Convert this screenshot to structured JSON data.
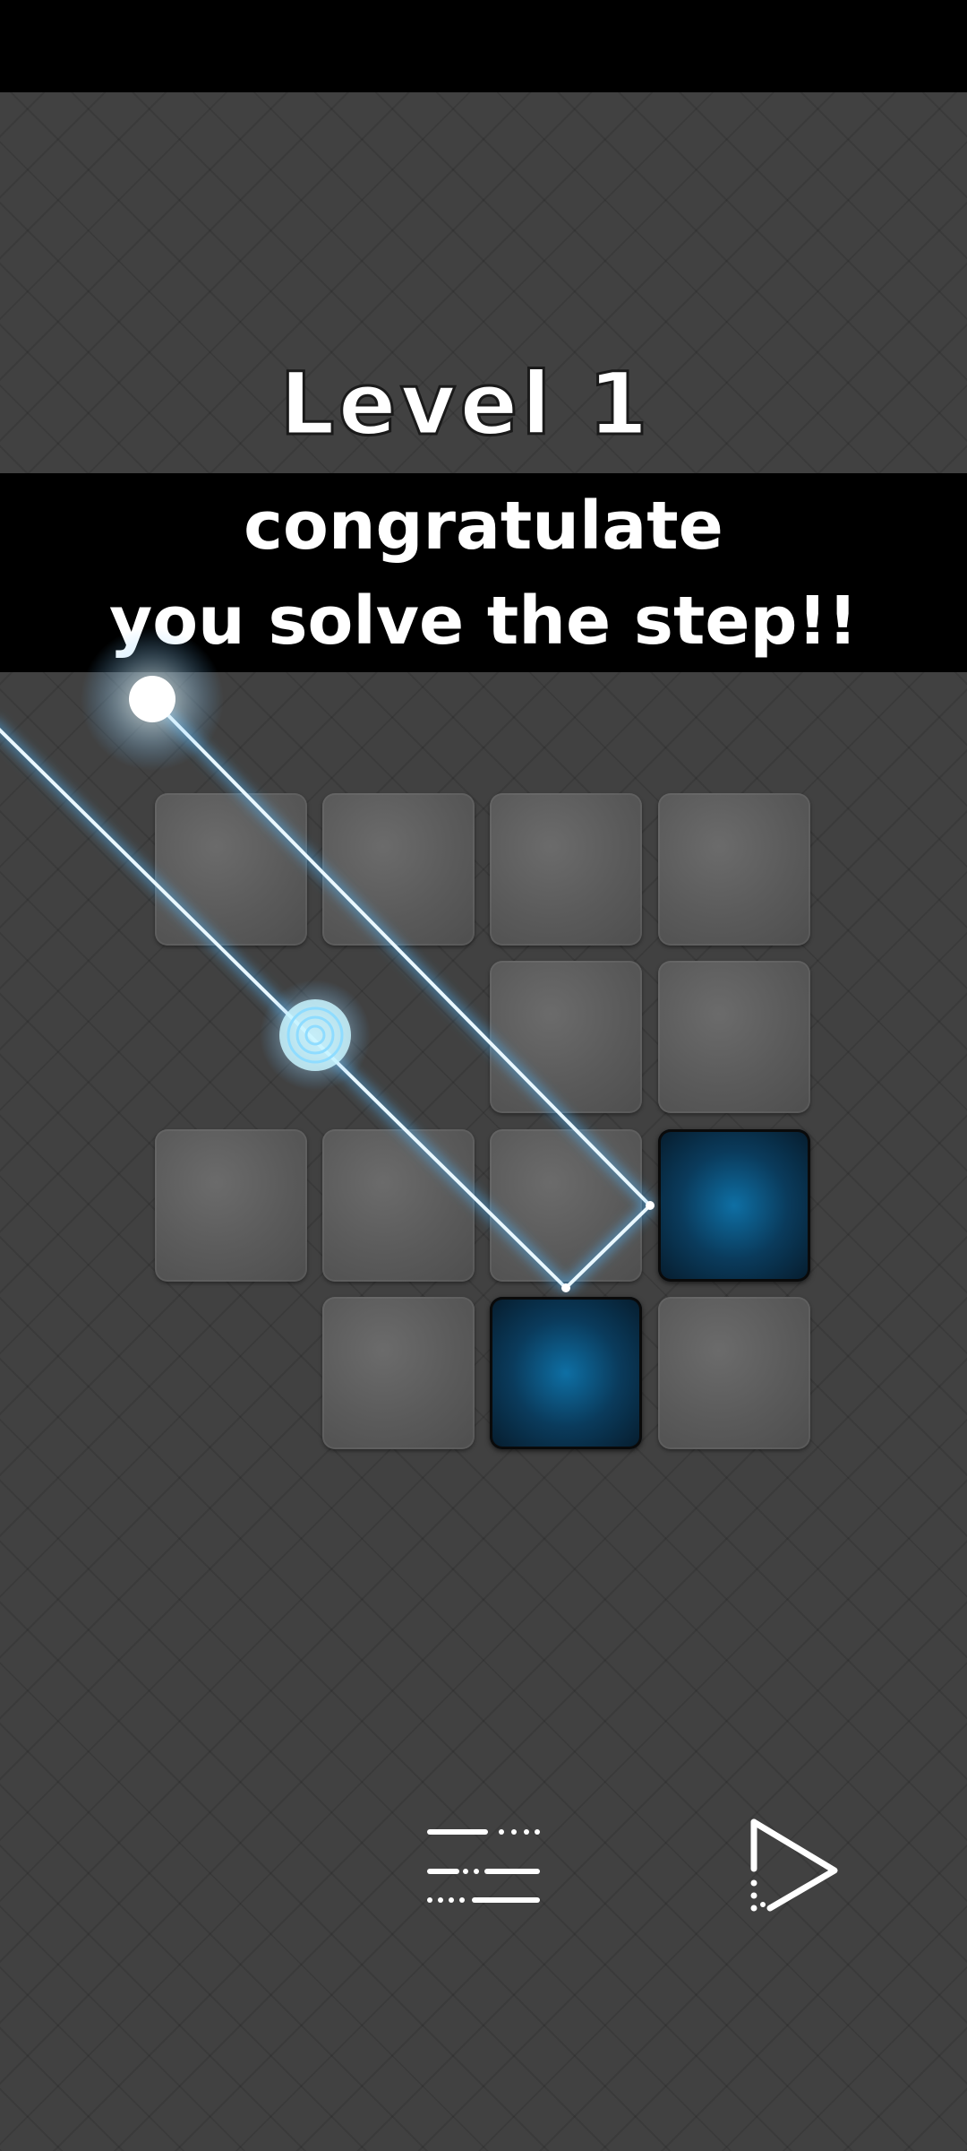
{
  "game": {
    "level_title": "Level 1",
    "banner": {
      "line1": "congratulate",
      "line2": "you solve the step!!"
    },
    "board": {
      "tiles": [
        {
          "row": 0,
          "col": 0,
          "state": "stone"
        },
        {
          "row": 0,
          "col": 1,
          "state": "stone"
        },
        {
          "row": 0,
          "col": 2,
          "state": "stone"
        },
        {
          "row": 0,
          "col": 3,
          "state": "stone"
        },
        {
          "row": 1,
          "col": 2,
          "state": "stone"
        },
        {
          "row": 1,
          "col": 3,
          "state": "stone"
        },
        {
          "row": 2,
          "col": 0,
          "state": "stone"
        },
        {
          "row": 2,
          "col": 1,
          "state": "stone"
        },
        {
          "row": 2,
          "col": 2,
          "state": "stone"
        },
        {
          "row": 2,
          "col": 3,
          "state": "lit-target"
        },
        {
          "row": 3,
          "col": 1,
          "state": "stone"
        },
        {
          "row": 3,
          "col": 2,
          "state": "lit-target"
        },
        {
          "row": 3,
          "col": 3,
          "state": "stone"
        }
      ]
    },
    "controls": {
      "menu_icon": "menu-list-icon",
      "next_icon": "play-next-icon"
    },
    "colors": {
      "background": "#414141",
      "laser": "#7fd4ff",
      "target": "#0e6fa4",
      "banner": "#000000"
    }
  }
}
